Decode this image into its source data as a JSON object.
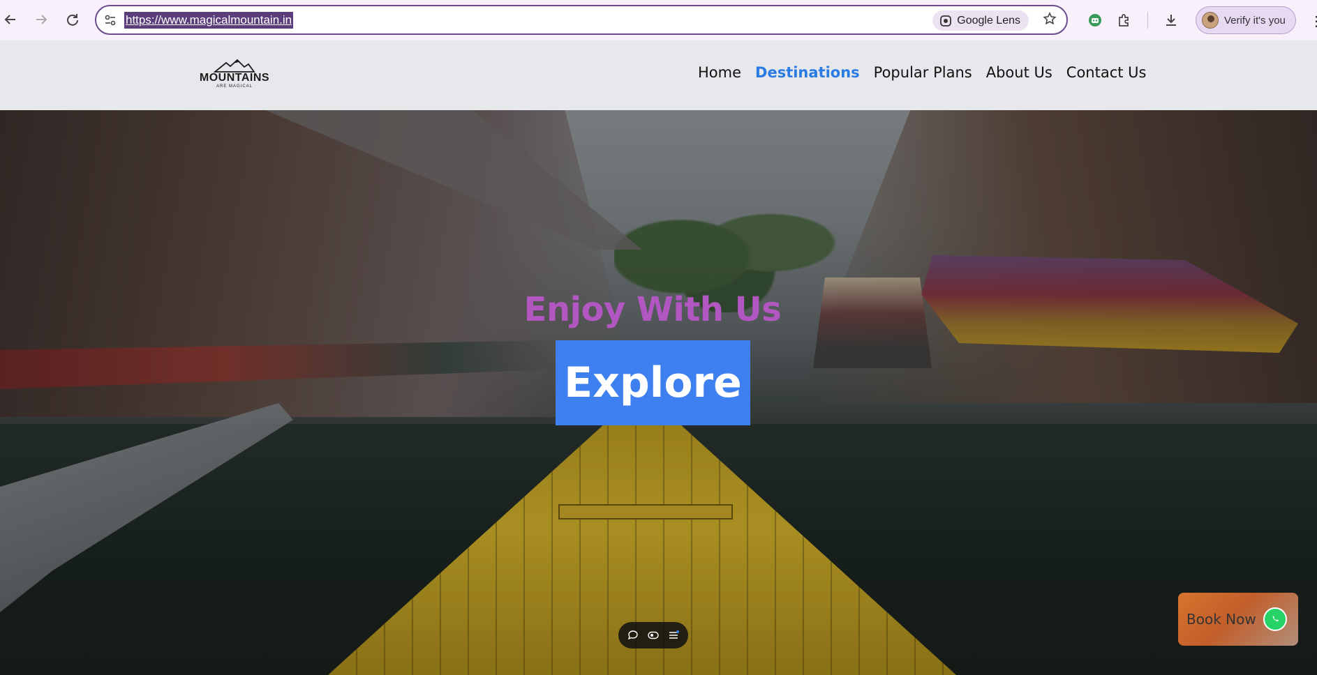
{
  "browser": {
    "url": "https://www.magicalmountain.in",
    "lens_label": "Google Lens",
    "profile_label": "Verify it's you"
  },
  "site": {
    "logo": {
      "title": "MOUNTAINS",
      "subtitle": "ARE MAGICAL"
    },
    "nav": [
      {
        "label": "Home",
        "active": false
      },
      {
        "label": "Destinations",
        "active": true
      },
      {
        "label": "Popular Plans",
        "active": false
      },
      {
        "label": "About Us",
        "active": false
      },
      {
        "label": "Contact Us",
        "active": false
      }
    ]
  },
  "hero": {
    "subtitle": "Enjoy With Us",
    "cta_label": "Explore"
  },
  "book_now": {
    "label": "Book Now"
  },
  "colors": {
    "nav_active": "#2a7be4",
    "hero_subtitle": "#b256c1",
    "cta_bg": "#3e80f0",
    "book_now_bg": "#d9742f",
    "whatsapp": "#25d366"
  }
}
